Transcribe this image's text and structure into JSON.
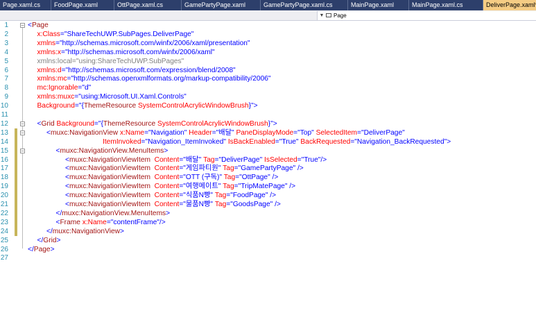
{
  "tabs": [
    {
      "label": "Page.xaml.cs",
      "active": false
    },
    {
      "label": "FoodPage.xaml",
      "active": false
    },
    {
      "label": "OttPage.xaml.cs",
      "active": false
    },
    {
      "label": "GamePartyPage.xaml",
      "active": false
    },
    {
      "label": "GamePartyPage.xaml.cs",
      "active": false
    },
    {
      "label": "MainPage.xaml",
      "active": false
    },
    {
      "label": "MainPage.xaml.cs",
      "active": false
    },
    {
      "label": "DeliverPage.xaml*",
      "active": true
    }
  ],
  "navbar": {
    "element_label": "Page"
  },
  "colors": {
    "tab_bar": "#2d3f6b",
    "active_tab": "#f5cc84",
    "line_number": "#2b91af",
    "modified_marker": "#c7b55a"
  },
  "lines": [
    {
      "n": "1",
      "ind": 0,
      "mod": false,
      "fold": "open",
      "segs": [
        [
          "b",
          "<"
        ],
        [
          "t",
          "Page"
        ]
      ]
    },
    {
      "n": "2",
      "ind": 1,
      "mod": false,
      "segs": [
        [
          "a",
          "x:Class"
        ],
        [
          "b",
          "="
        ],
        [
          "v",
          "\"ShareTechUWP.SubPages.DeliverPage\""
        ]
      ]
    },
    {
      "n": "3",
      "ind": 1,
      "mod": false,
      "segs": [
        [
          "a",
          "xmlns"
        ],
        [
          "b",
          "="
        ],
        [
          "v",
          "\"http://schemas.microsoft.com/winfx/2006/xaml/presentation\""
        ]
      ]
    },
    {
      "n": "4",
      "ind": 1,
      "mod": false,
      "segs": [
        [
          "a",
          "xmlns:x"
        ],
        [
          "b",
          "="
        ],
        [
          "v",
          "\"http://schemas.microsoft.com/winfx/2006/xaml\""
        ]
      ]
    },
    {
      "n": "5",
      "ind": 1,
      "mod": false,
      "segs": [
        [
          "g",
          "xmlns:local=\"using:ShareTechUWP.SubPages\""
        ]
      ]
    },
    {
      "n": "6",
      "ind": 1,
      "mod": false,
      "segs": [
        [
          "a",
          "xmlns:d"
        ],
        [
          "b",
          "="
        ],
        [
          "v",
          "\"http://schemas.microsoft.com/expression/blend/2008\""
        ]
      ]
    },
    {
      "n": "7",
      "ind": 1,
      "mod": false,
      "segs": [
        [
          "a",
          "xmlns:mc"
        ],
        [
          "b",
          "="
        ],
        [
          "v",
          "\"http://schemas.openxmlformats.org/markup-compatibility/2006\""
        ]
      ]
    },
    {
      "n": "8",
      "ind": 1,
      "mod": false,
      "segs": [
        [
          "a",
          "mc:Ignorable"
        ],
        [
          "b",
          "="
        ],
        [
          "v",
          "\"d\""
        ]
      ]
    },
    {
      "n": "9",
      "ind": 1,
      "mod": false,
      "segs": [
        [
          "a",
          "xmlns:muxc"
        ],
        [
          "b",
          "="
        ],
        [
          "v",
          "\"using:Microsoft.UI.Xaml.Controls\""
        ]
      ]
    },
    {
      "n": "10",
      "ind": 1,
      "mod": false,
      "segs": [
        [
          "a",
          "Background"
        ],
        [
          "b",
          "=\"{"
        ],
        [
          "t",
          "ThemeResource"
        ],
        [
          "a",
          " SystemControlAcrylicWindowBrush"
        ],
        [
          "b",
          "}\">"
        ]
      ]
    },
    {
      "n": "11",
      "ind": 0,
      "mod": false,
      "segs": []
    },
    {
      "n": "12",
      "ind": 1,
      "mod": false,
      "fold": "open",
      "segs": [
        [
          "b",
          "<"
        ],
        [
          "t",
          "Grid"
        ],
        [
          "a",
          " Background"
        ],
        [
          "b",
          "=\"{"
        ],
        [
          "t",
          "ThemeResource"
        ],
        [
          "a",
          " SystemControlAcrylicWindowBrush"
        ],
        [
          "b",
          "}\">"
        ]
      ]
    },
    {
      "n": "13",
      "ind": 2,
      "mod": true,
      "fold": "open",
      "segs": [
        [
          "b",
          "<"
        ],
        [
          "t",
          "muxc:NavigationView"
        ],
        [
          "a",
          " x:Name"
        ],
        [
          "b",
          "=\"Navigation\""
        ],
        [
          "a",
          " Header"
        ],
        [
          "b",
          "=\"배달\""
        ],
        [
          "a",
          " PaneDisplayMode"
        ],
        [
          "b",
          "=\"Top\""
        ],
        [
          "a",
          " SelectedItem"
        ],
        [
          "b",
          "=\"DeliverPage\""
        ]
      ]
    },
    {
      "n": "14",
      "ind": 8,
      "mod": true,
      "segs": [
        [
          "a",
          "ItemInvoked"
        ],
        [
          "b",
          "=\"Navigation_ItemInvoked\""
        ],
        [
          "a",
          " IsBackEnabled"
        ],
        [
          "b",
          "=\"True\""
        ],
        [
          "a",
          " BackRequested"
        ],
        [
          "b",
          "=\"Navigation_BackRequested\">"
        ]
      ]
    },
    {
      "n": "15",
      "ind": 3,
      "mod": true,
      "fold": "open",
      "segs": [
        [
          "b",
          "<"
        ],
        [
          "t",
          "muxc:NavigationView.MenuItems"
        ],
        [
          "b",
          ">"
        ]
      ]
    },
    {
      "n": "16",
      "ind": 4,
      "mod": true,
      "segs": [
        [
          "b",
          "<"
        ],
        [
          "t",
          "muxc:NavigationViewItem"
        ],
        [
          "a",
          "  Content"
        ],
        [
          "b",
          "=\"배달\""
        ],
        [
          "a",
          " Tag"
        ],
        [
          "b",
          "=\"DeliverPage\""
        ],
        [
          "a",
          " IsSelected"
        ],
        [
          "b",
          "=\"True\"/>"
        ]
      ]
    },
    {
      "n": "17",
      "ind": 4,
      "mod": true,
      "segs": [
        [
          "b",
          "<"
        ],
        [
          "t",
          "muxc:NavigationViewItem"
        ],
        [
          "a",
          "  Content"
        ],
        [
          "b",
          "=\"게임파티원\""
        ],
        [
          "a",
          " Tag"
        ],
        [
          "b",
          "=\"GamePartyPage\" />"
        ]
      ]
    },
    {
      "n": "18",
      "ind": 4,
      "mod": true,
      "segs": [
        [
          "b",
          "<"
        ],
        [
          "t",
          "muxc:NavigationViewItem"
        ],
        [
          "a",
          "  Content"
        ],
        [
          "b",
          "=\"OTT (구독)\""
        ],
        [
          "a",
          " Tag"
        ],
        [
          "b",
          "=\"OttPage\" />"
        ]
      ]
    },
    {
      "n": "19",
      "ind": 4,
      "mod": true,
      "segs": [
        [
          "b",
          "<"
        ],
        [
          "t",
          "muxc:NavigationViewItem"
        ],
        [
          "a",
          "  Content"
        ],
        [
          "b",
          "=\"여행메이트\""
        ],
        [
          "a",
          " Tag"
        ],
        [
          "b",
          "=\"TripMatePage\" />"
        ]
      ]
    },
    {
      "n": "20",
      "ind": 4,
      "mod": true,
      "segs": [
        [
          "b",
          "<"
        ],
        [
          "t",
          "muxc:NavigationViewItem"
        ],
        [
          "a",
          "  Content"
        ],
        [
          "b",
          "=\"식품N빵\""
        ],
        [
          "a",
          " Tag"
        ],
        [
          "b",
          "=\"FoodPage\" />"
        ]
      ]
    },
    {
      "n": "21",
      "ind": 4,
      "mod": true,
      "segs": [
        [
          "b",
          "<"
        ],
        [
          "t",
          "muxc:NavigationViewItem"
        ],
        [
          "a",
          "  Content"
        ],
        [
          "b",
          "=\"물품N빵\""
        ],
        [
          "a",
          " Tag"
        ],
        [
          "b",
          "=\"GoodsPage\" />"
        ]
      ]
    },
    {
      "n": "22",
      "ind": 3,
      "mod": true,
      "segs": [
        [
          "b",
          "</"
        ],
        [
          "t",
          "muxc:NavigationView.MenuItems"
        ],
        [
          "b",
          ">"
        ]
      ]
    },
    {
      "n": "23",
      "ind": 3,
      "mod": true,
      "segs": [
        [
          "b",
          "<"
        ],
        [
          "t",
          "Frame"
        ],
        [
          "a",
          " x:Name"
        ],
        [
          "b",
          "=\"contentFrame\"/>"
        ]
      ]
    },
    {
      "n": "24",
      "ind": 2,
      "mod": true,
      "segs": [
        [
          "b",
          "</"
        ],
        [
          "t",
          "muxc:NavigationView"
        ],
        [
          "b",
          ">"
        ]
      ]
    },
    {
      "n": "25",
      "ind": 1,
      "mod": false,
      "segs": [
        [
          "b",
          "</"
        ],
        [
          "t",
          "Grid"
        ],
        [
          "b",
          ">"
        ]
      ]
    },
    {
      "n": "26",
      "ind": 0,
      "mod": false,
      "segs": [
        [
          "b",
          "</"
        ],
        [
          "t",
          "Page"
        ],
        [
          "b",
          ">"
        ]
      ]
    },
    {
      "n": "27",
      "ind": 0,
      "mod": false,
      "segs": []
    }
  ]
}
